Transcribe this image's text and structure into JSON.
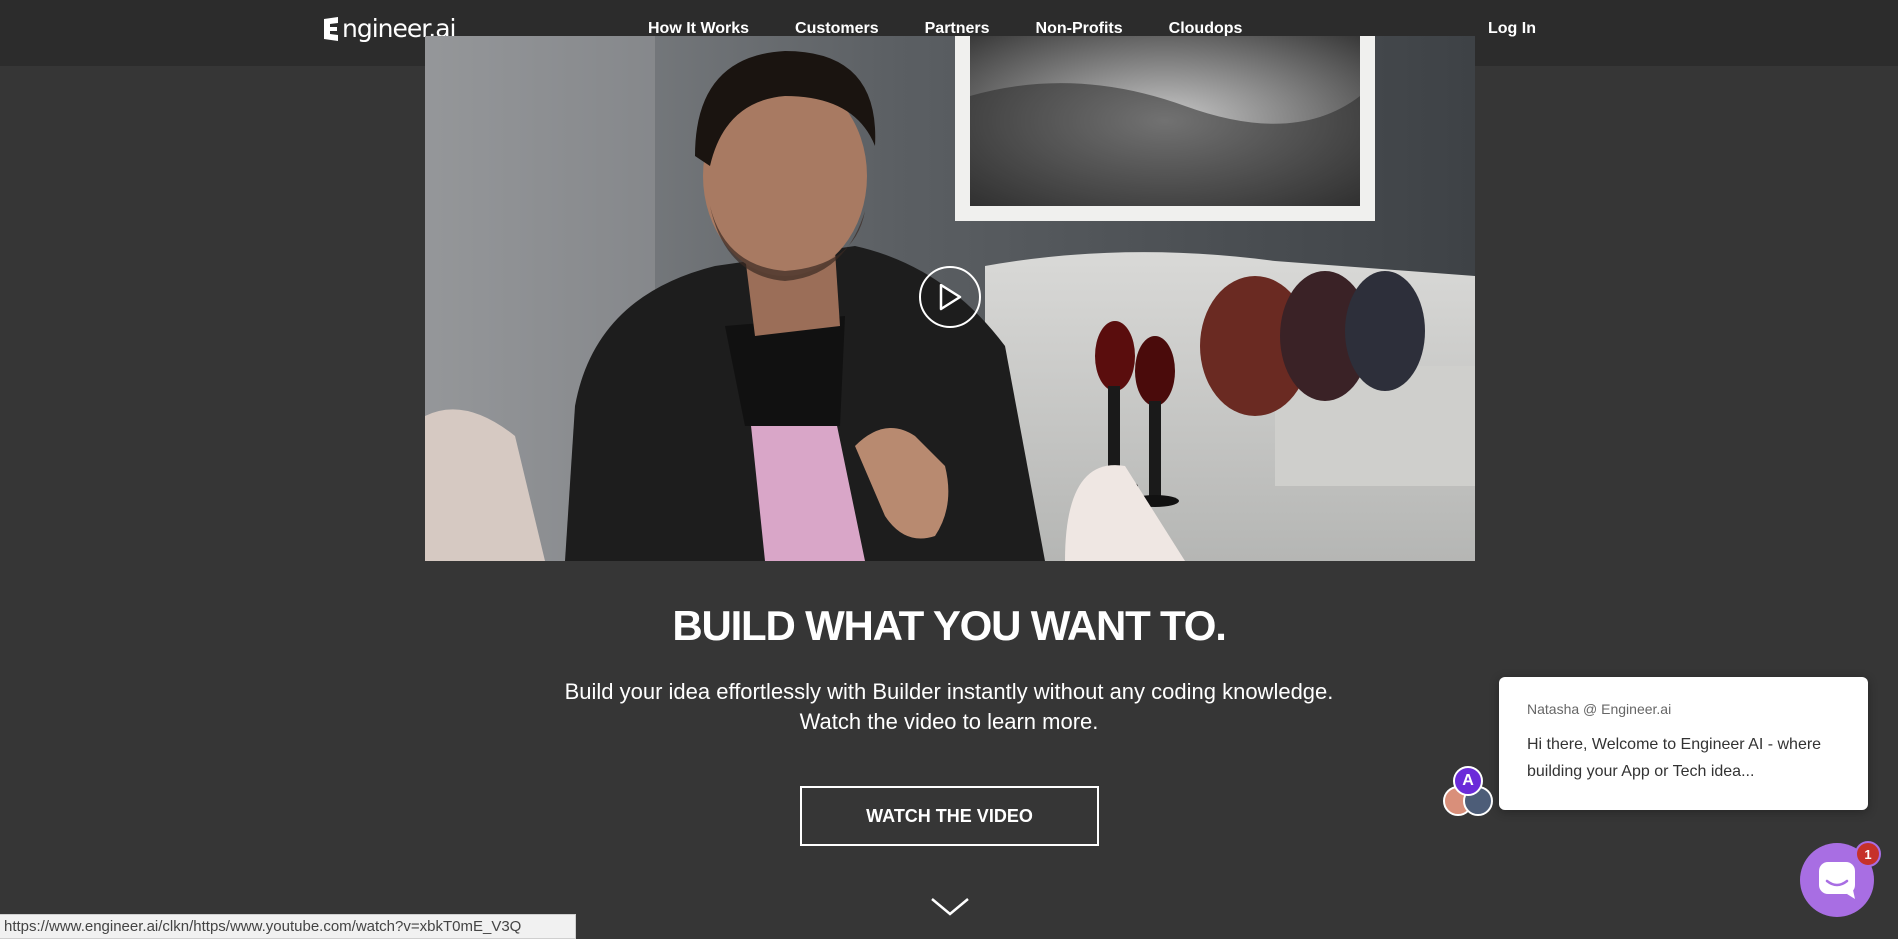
{
  "brand": {
    "logo_text": "ngineer.ai"
  },
  "nav": {
    "items": [
      "How It Works",
      "Customers",
      "Partners",
      "Non-Profits",
      "Cloudops"
    ],
    "login": "Log In"
  },
  "hero": {
    "headline": "BUILD WHAT YOU WANT TO.",
    "subtext": "Build your idea effortlessly with Builder instantly without any coding knowledge. Watch the video to learn more.",
    "cta": "WATCH THE VIDEO"
  },
  "status_url": "https://www.engineer.ai/clkn/https/www.youtube.com/watch?v=xbkT0mE_V3Q",
  "chat": {
    "sender": "Natasha @ Engineer.ai",
    "message": "Hi there,  Welcome to Engineer AI - where building your App or Tech idea...",
    "avatar_letter": "A",
    "unread_count": "1"
  },
  "colors": {
    "background": "#363636",
    "topbar": "#2c2c2c",
    "launcher": "#a86ee3",
    "badge": "#c6312a"
  },
  "icons": [
    "play-icon",
    "chevron-down-icon",
    "chat-icon"
  ]
}
